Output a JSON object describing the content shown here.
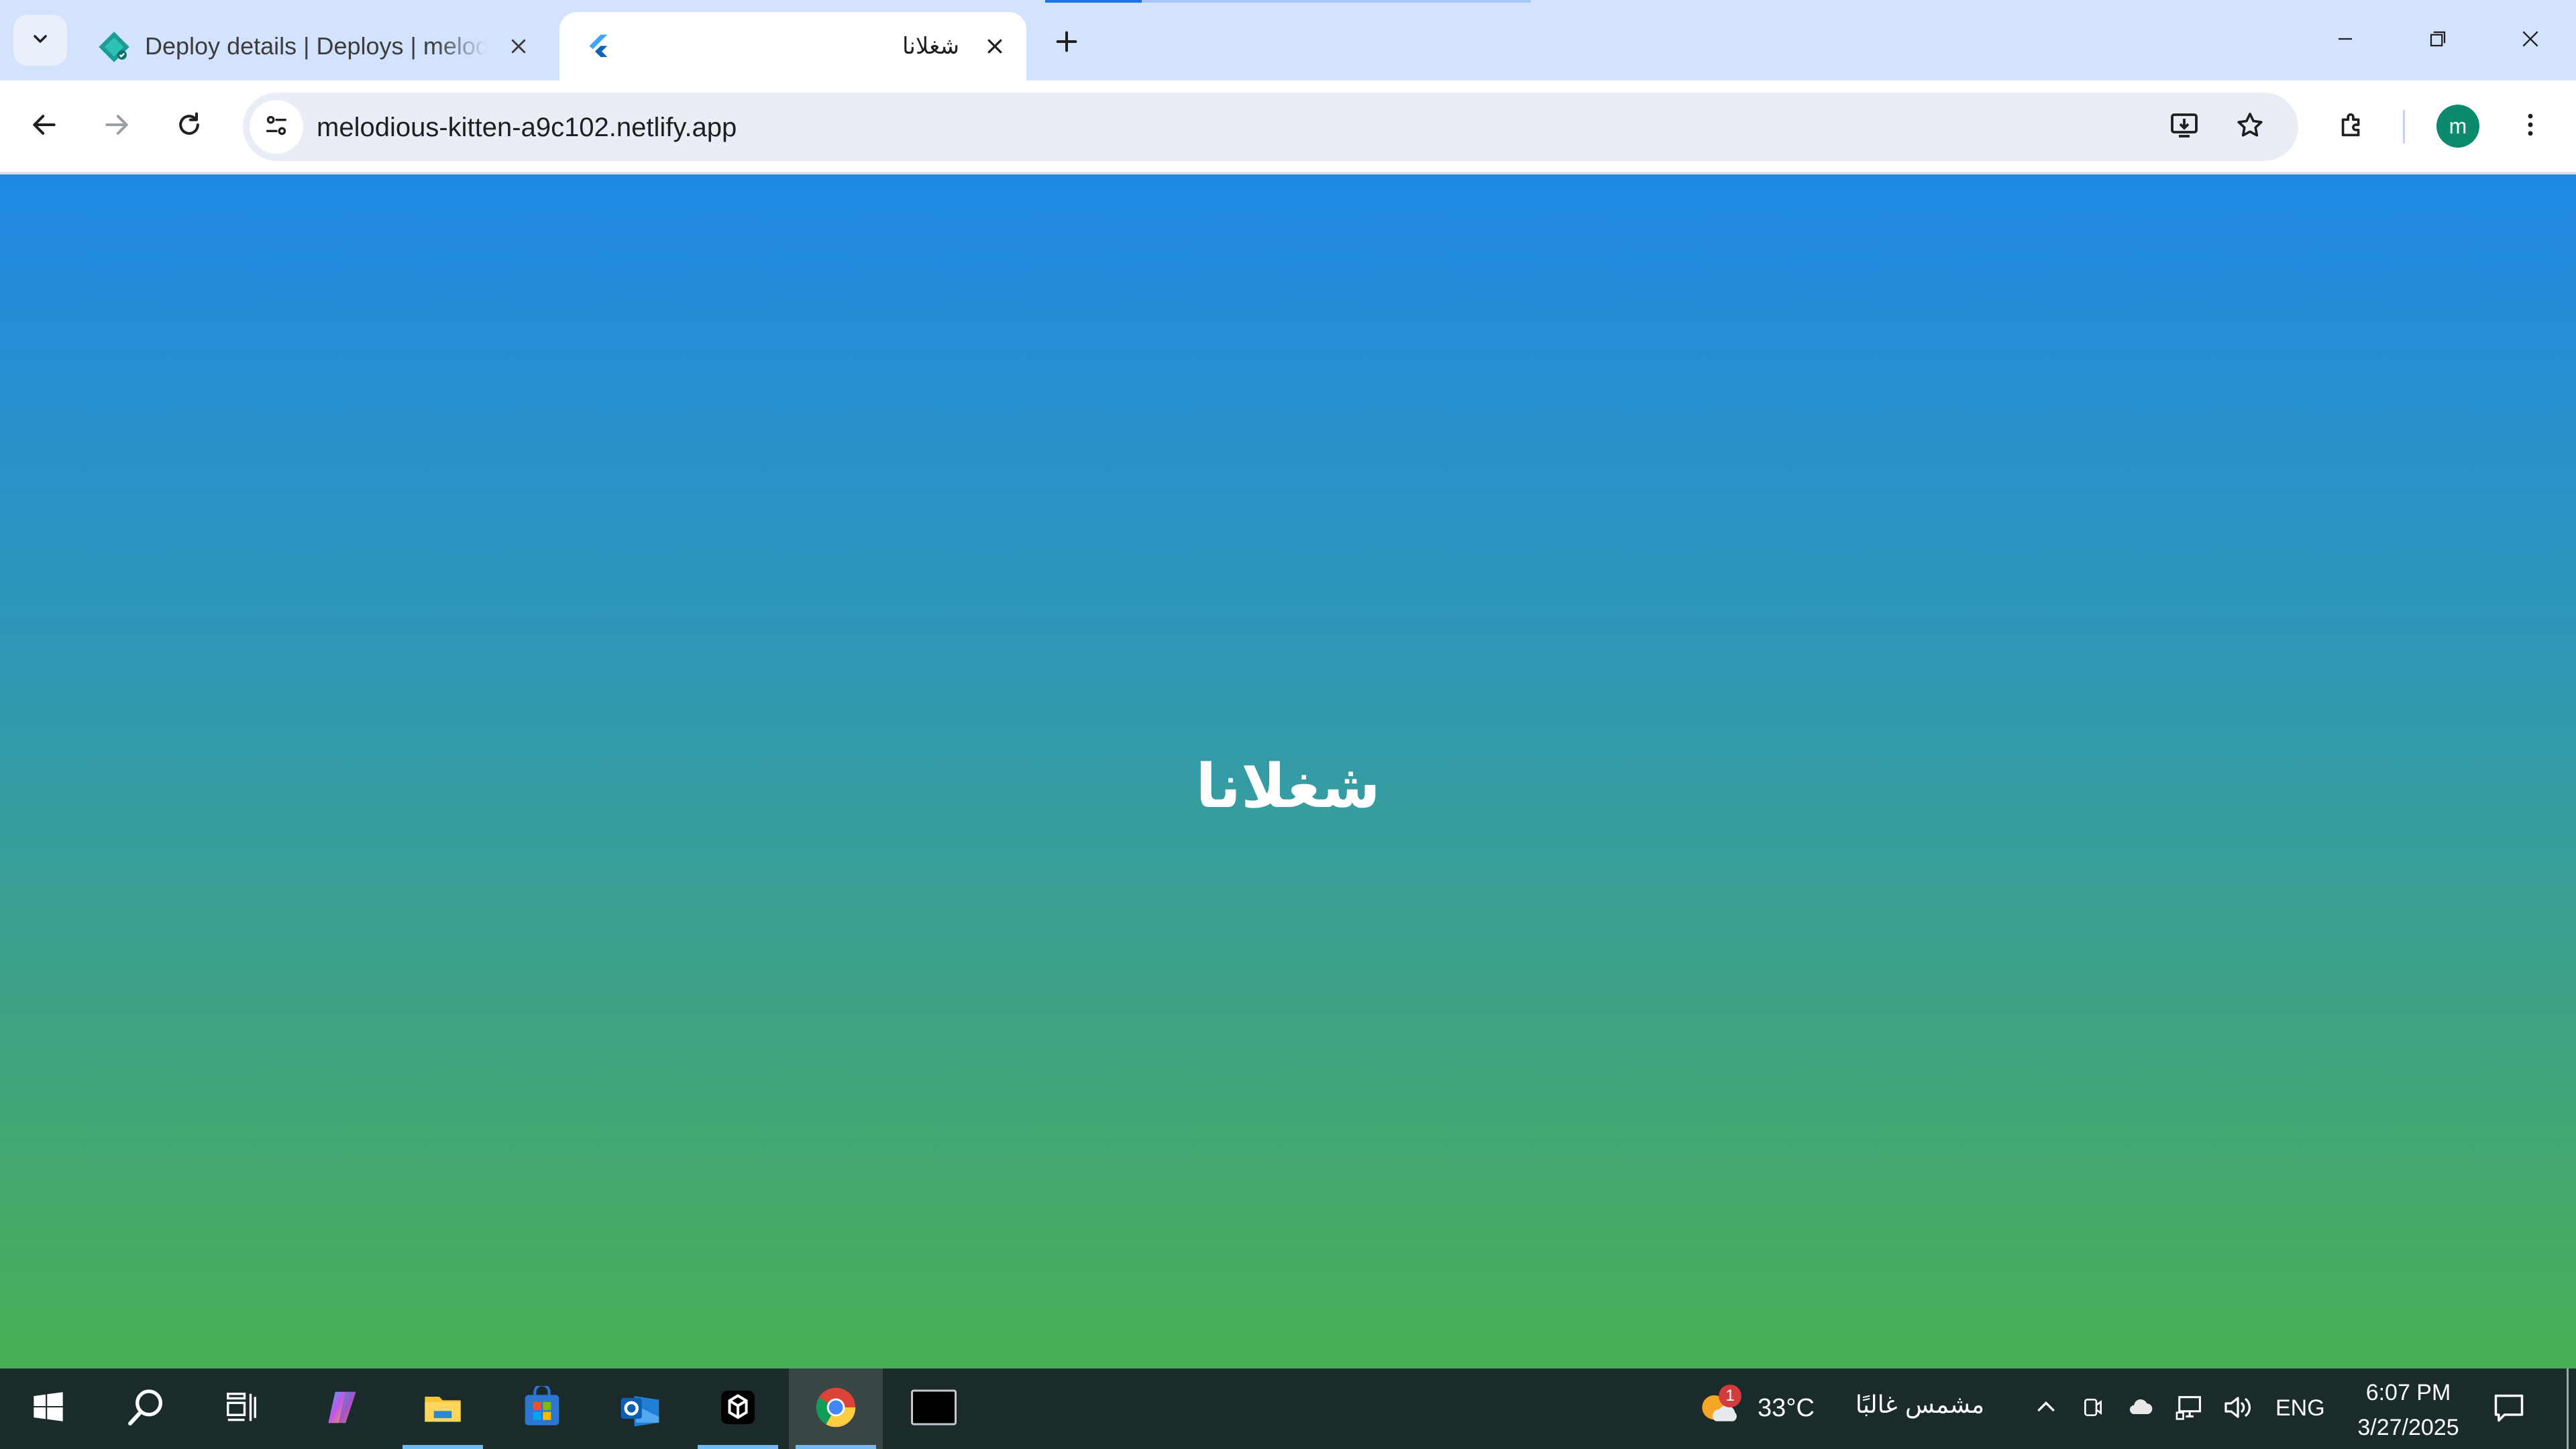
{
  "browser": {
    "tabs": [
      {
        "title": "Deploy details | Deploys | melodious-kitten-a9c102 | Netlify",
        "favicon": "netlify-icon",
        "active": false
      },
      {
        "title": "شغلانا",
        "favicon": "flutter-icon",
        "active": true
      }
    ],
    "new_tab_icon": "plus-icon",
    "window_controls": [
      "minimize-icon",
      "restore-icon",
      "close-icon"
    ]
  },
  "toolbar": {
    "url": "melodious-kitten-a9c102.netlify.app",
    "buttons": [
      "back-icon",
      "forward-icon",
      "reload-icon"
    ],
    "right_icons": [
      "install-app-icon",
      "bookmark-star-icon",
      "extensions-icon",
      "profile-avatar",
      "menu-icon"
    ],
    "avatar_letter": "m",
    "avatar_color": "#0b8a6e"
  },
  "page": {
    "title": "شغلانا",
    "gradient": {
      "top": "#2089e5",
      "bottom": "#4ab055"
    }
  },
  "taskbar": {
    "apps": [
      "start-icon",
      "search-icon",
      "task-view-icon",
      "copilot-icon",
      "file-explorer-icon",
      "microsoft-store-icon",
      "outlook-icon",
      "app-icon",
      "chrome-icon",
      "terminal-icon"
    ],
    "weather": {
      "badge": "1",
      "temp": "33°C",
      "condition": "مشمس غالبًا"
    },
    "language": "ENG",
    "time": "6:07 PM",
    "date": "3/27/2025"
  }
}
